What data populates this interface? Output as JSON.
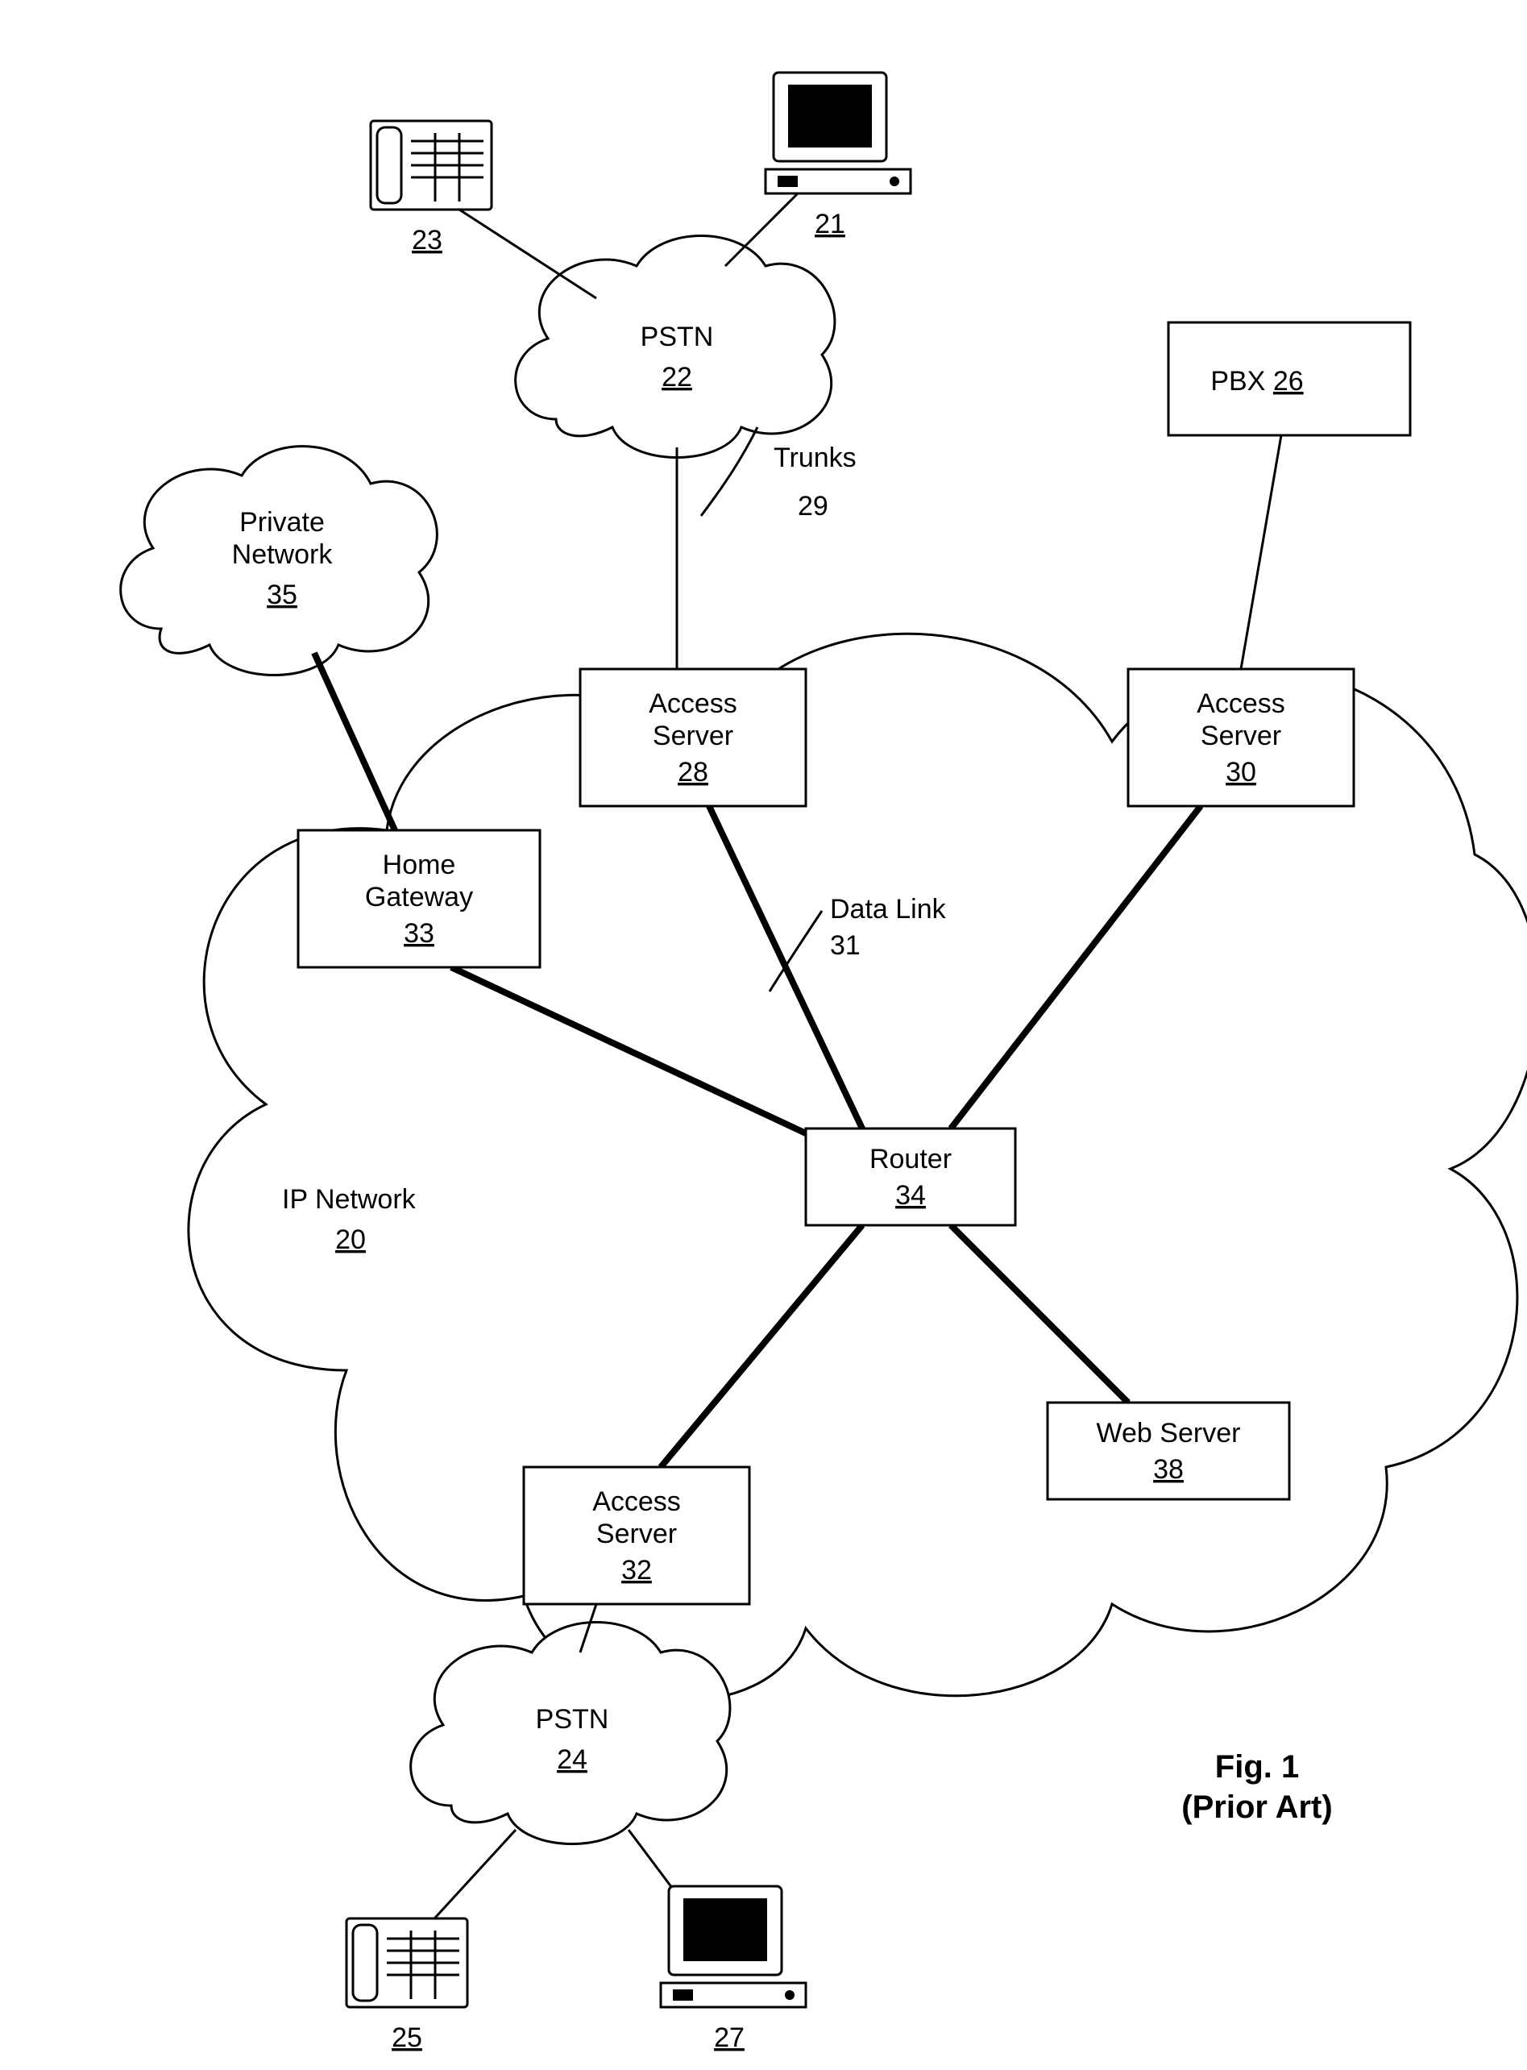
{
  "diagram": {
    "title": "Fig. 1",
    "subtitle": "(Prior Art)",
    "nodes": {
      "computer_top": {
        "ref": "21"
      },
      "phone_top": {
        "ref": "23"
      },
      "pstn_top": {
        "name": "PSTN",
        "ref": "22"
      },
      "pbx": {
        "name": "PBX",
        "ref": "26"
      },
      "private_net": {
        "name1": "Private",
        "name2": "Network",
        "ref": "35"
      },
      "trunks": {
        "name": "Trunks",
        "ref": "29"
      },
      "access_top": {
        "name1": "Access",
        "name2": "Server",
        "ref": "28"
      },
      "access_right": {
        "name1": "Access",
        "name2": "Server",
        "ref": "30"
      },
      "home_gw": {
        "name1": "Home",
        "name2": "Gateway",
        "ref": "33"
      },
      "datalink": {
        "name": "Data Link",
        "ref": "31"
      },
      "router": {
        "name": "Router",
        "ref": "34"
      },
      "ip_network": {
        "name": "IP Network",
        "ref": "20"
      },
      "web_server": {
        "name": "Web Server",
        "ref": "38"
      },
      "access_bottom": {
        "name1": "Access",
        "name2": "Server",
        "ref": "32"
      },
      "pstn_bottom": {
        "name": "PSTN",
        "ref": "24"
      },
      "phone_bottom": {
        "ref": "25"
      },
      "computer_bottom": {
        "ref": "27"
      }
    }
  }
}
